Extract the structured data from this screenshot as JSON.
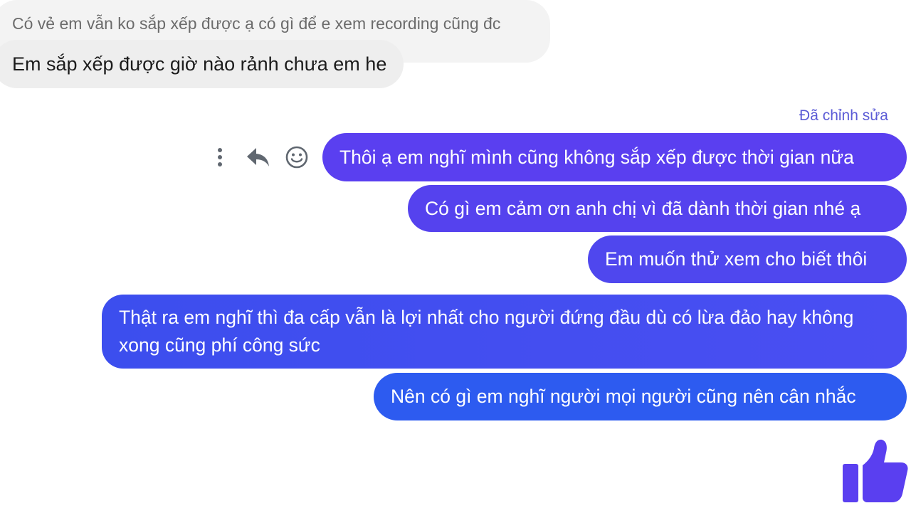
{
  "conversation": {
    "reply_preview": "Có vẻ em vẫn ko sắp xếp được ạ có gì để e xem recording cũng đc",
    "incoming_message": "Em sắp xếp được giờ nào rảnh chưa em he",
    "edited_label": "Đã chỉnh sửa",
    "outgoing_messages": [
      "Thôi ạ em nghĩ mình cũng không sắp xếp được thời gian nữa",
      "Có gì em cảm ơn anh chị vì đã dành thời gian nhé ạ",
      "Em muốn thử xem cho biết thôi",
      "Thật ra em nghĩ thì đa cấp vẫn là lợi nhất cho người đứng đầu dù có lừa đảo hay không xong cũng phí công sức",
      "Nên có gì em nghĩ người mọi người cũng nên cân nhắc"
    ]
  },
  "message_actions": {
    "icons": [
      "more-vertical-icon",
      "reply-icon",
      "emoji-icon"
    ]
  },
  "like_button": {
    "icon": "thumbs-up-icon",
    "color": "#5a3ff0"
  },
  "colors": {
    "outgoing_top": "#5a3ff0",
    "outgoing_bottom": "#2d5bf0",
    "incoming_bg": "#eeeeee",
    "edited_label": "#5b5bd6"
  }
}
